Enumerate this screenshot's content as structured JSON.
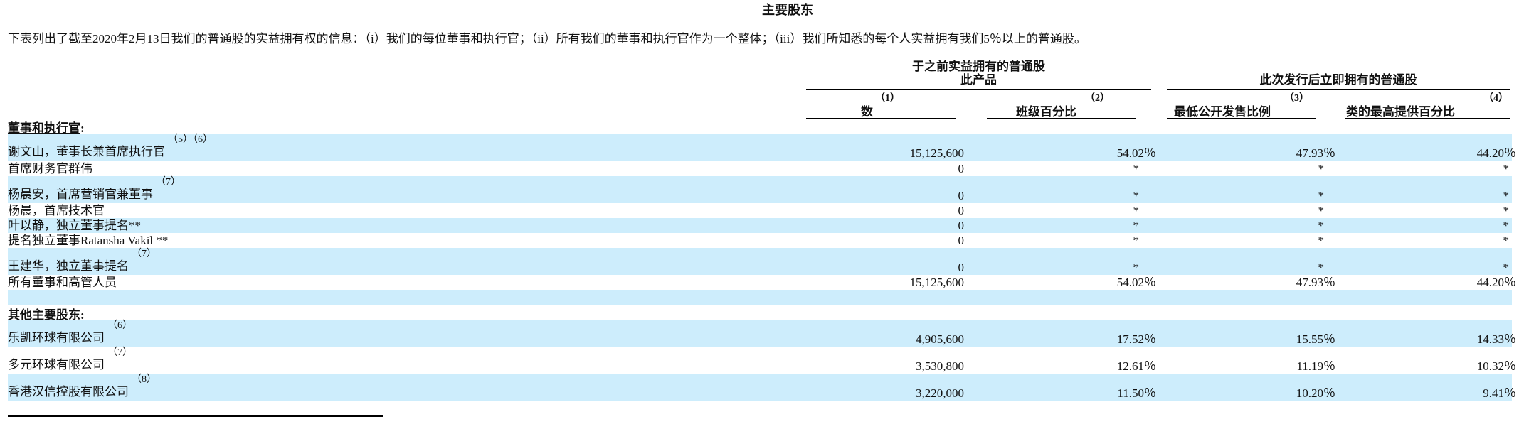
{
  "title": "主要股东",
  "intro": "下表列出了截至2020年2月13日我们的普通股的实益拥有权的信息：（i）我们的每位董事和执行官；（ii）所有我们的董事和执行官作为一个整体；（iii）我们所知悉的每个人实益拥有我们5％以上的普通股。",
  "header": {
    "group1_line1": "于之前实益拥有的普通股",
    "group1_line2": "此产品",
    "group2": "此次发行后立即拥有的普通股",
    "columns": [
      {
        "note": "（1）",
        "label": "数"
      },
      {
        "note": "（2）",
        "label": "班级百分比"
      },
      {
        "note": "（3）",
        "label": "最低公开发售比例"
      },
      {
        "note": "（4）",
        "label": "类的最高提供百分比"
      }
    ]
  },
  "sections": {
    "directors": "董事和执行官",
    "others": "其他主要股东",
    "colon": ":"
  },
  "rows": [
    {
      "name": "谢文山，董事长兼首席执行官",
      "note": "（5）（6）",
      "shares": "15,125,600",
      "pct": "54.02％",
      "min": "47.93％",
      "max": "44.20％"
    },
    {
      "name": "首席财务官群伟",
      "shares": "0",
      "pct": "*",
      "min": "*",
      "max": "*"
    },
    {
      "name": "杨晨安，首席营销官兼董事",
      "note": "（7）",
      "shares": "0",
      "pct": "*",
      "min": "*",
      "max": "*"
    },
    {
      "name": "杨晨，首席技术官",
      "shares": "0",
      "pct": "*",
      "min": "*",
      "max": "*"
    },
    {
      "name": "叶以静，独立董事提名**",
      "shares": "0",
      "pct": "*",
      "min": "*",
      "max": "*"
    },
    {
      "name": "提名独立董事Ratansha Vakil **",
      "shares": "0",
      "pct": "*",
      "min": "*",
      "max": "*"
    },
    {
      "name": "王建华，独立董事提名",
      "note": "（7）",
      "shares": "0",
      "pct": "*",
      "min": "*",
      "max": "*"
    },
    {
      "name": "所有董事和高管人员",
      "shares": "15,125,600",
      "pct": "54.02％",
      "min": "47.93％",
      "max": "44.20％"
    },
    {
      "name": "乐凯环球有限公司",
      "note": "（6）",
      "shares": "4,905,600",
      "pct": "17.52％",
      "min": "15.55％",
      "max": "14.33％"
    },
    {
      "name": "多元环球有限公司",
      "note": "（7）",
      "shares": "3,530,800",
      "pct": "12.61％",
      "min": "11.19％",
      "max": "10.32％"
    },
    {
      "name": "香港汉信控股有限公司",
      "note": "（8）",
      "shares": "3,220,000",
      "pct": "11.50％",
      "min": "10.20％",
      "max": "9.41％"
    }
  ]
}
